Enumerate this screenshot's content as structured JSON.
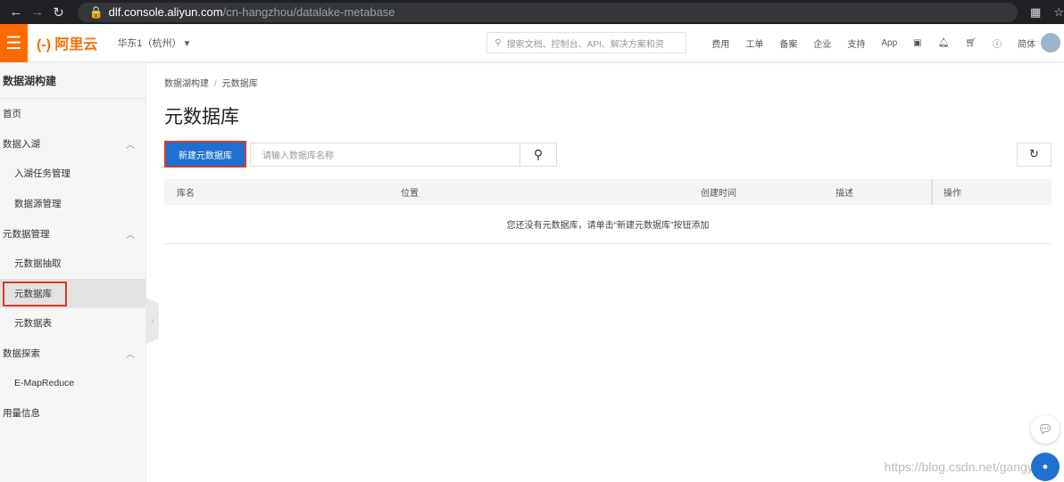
{
  "browser": {
    "host": "dlf.console.aliyun.com",
    "path": "/cn-hangzhou/datalake-metabase"
  },
  "topbar": {
    "logo": "(-) 阿里云",
    "region": "华东1（杭州）",
    "search_placeholder": "搜索文档、控制台、API、解决方案和资",
    "links": [
      "费用",
      "工单",
      "备案",
      "企业",
      "支持",
      "App"
    ],
    "lang": "简体"
  },
  "sidebar": {
    "title": "数据湖构建",
    "items": [
      {
        "label": "首页",
        "level": "top"
      },
      {
        "label": "数据入湖",
        "level": "top",
        "expanded": true
      },
      {
        "label": "入湖任务管理",
        "level": "sub"
      },
      {
        "label": "数据源管理",
        "level": "sub"
      },
      {
        "label": "元数据管理",
        "level": "top",
        "expanded": true
      },
      {
        "label": "元数据抽取",
        "level": "sub"
      },
      {
        "label": "元数据库",
        "level": "sub",
        "active": true
      },
      {
        "label": "元数据表",
        "level": "sub"
      },
      {
        "label": "数据探索",
        "level": "top",
        "expanded": true
      },
      {
        "label": "E-MapReduce",
        "level": "sub"
      },
      {
        "label": "用量信息",
        "level": "top"
      }
    ]
  },
  "main": {
    "breadcrumb": [
      "数据湖构建",
      "元数据库"
    ],
    "title": "元数据库",
    "new_button": "新建元数据库",
    "search_placeholder": "请输入数据库名称",
    "columns": [
      "库名",
      "位置",
      "创建时间",
      "描述",
      "操作"
    ],
    "empty_text": "您还没有元数据库，请单击“新建元数据库”按钮添加"
  },
  "watermark": "https://blog.csdn.net/gangyikeji",
  "colors": {
    "brand": "#ff6a00",
    "primary": "#1f6fd1",
    "highlight": "#d73a2a"
  }
}
